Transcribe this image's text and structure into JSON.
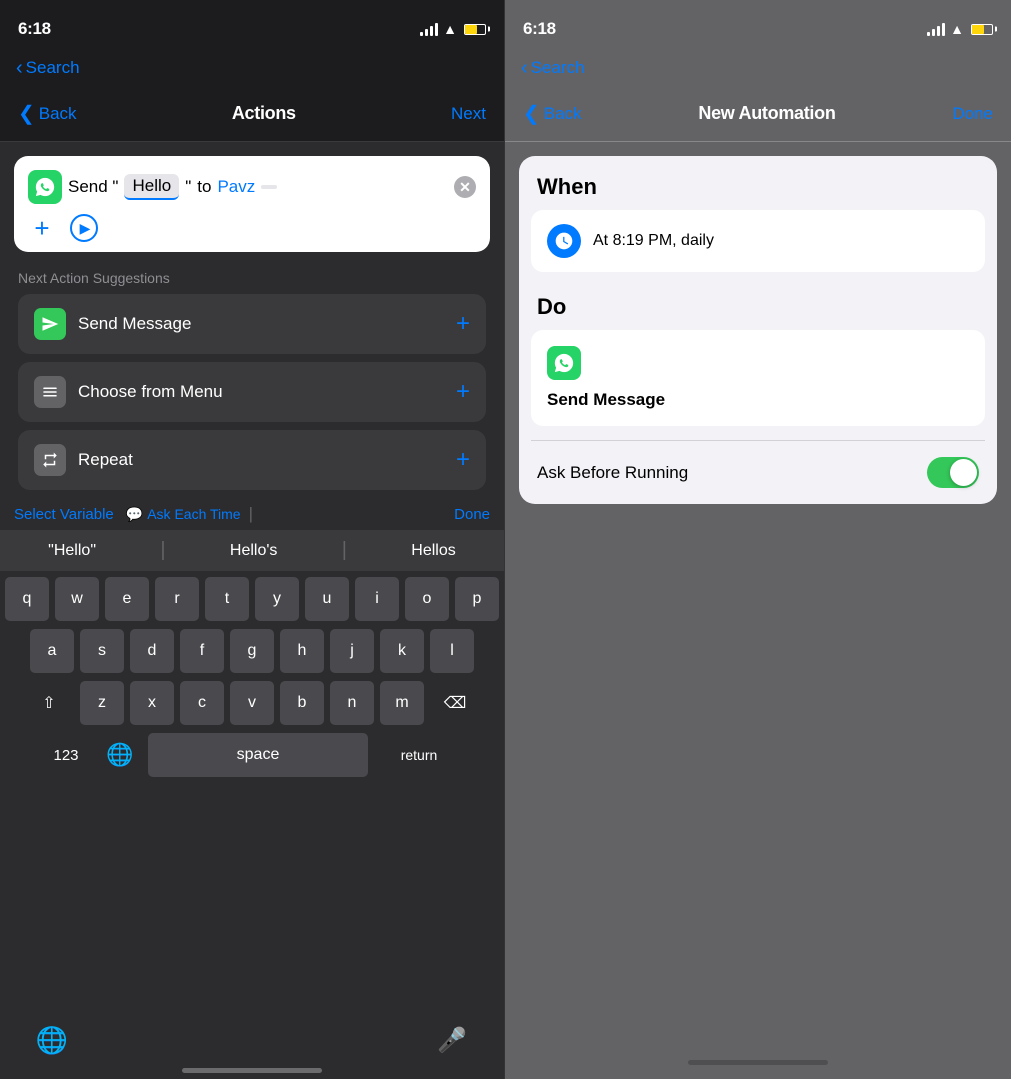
{
  "left": {
    "status": {
      "time": "6:18",
      "search_back": "Search"
    },
    "nav": {
      "back_label": "Back",
      "title": "Actions",
      "action_label": "Next"
    },
    "action_card": {
      "send_text": "Send \"",
      "hello_text": "Hello",
      "quote_close": "\"",
      "to_text": "to",
      "recipient": "Pavz"
    },
    "suggestions": {
      "label": "Next Action Suggestions",
      "items": [
        {
          "name": "Send Message",
          "icon_type": "green"
        },
        {
          "name": "Choose from Menu",
          "icon_type": "gray"
        },
        {
          "name": "Repeat",
          "icon_type": "gray"
        }
      ]
    },
    "toolbar": {
      "select_variable": "Select Variable",
      "ask_each_time": "Ask Each Time",
      "done": "Done"
    },
    "autocomplete": {
      "items": [
        "\"Hello\"",
        "Hello's",
        "Hellos"
      ]
    },
    "keyboard": {
      "rows": [
        [
          "q",
          "w",
          "e",
          "r",
          "t",
          "y",
          "u",
          "i",
          "o",
          "p"
        ],
        [
          "a",
          "s",
          "d",
          "f",
          "g",
          "h",
          "j",
          "k",
          "l"
        ],
        [
          "z",
          "x",
          "c",
          "v",
          "b",
          "n",
          "m"
        ]
      ],
      "bottom": {
        "nums": "123",
        "space": "space",
        "return": "return"
      }
    }
  },
  "right": {
    "status": {
      "time": "6:18",
      "search_back": "Search"
    },
    "nav": {
      "back_label": "Back",
      "title": "New Automation",
      "action_label": "Done"
    },
    "when_section": {
      "header": "When",
      "time_label": "At 8:19 PM, daily"
    },
    "do_section": {
      "header": "Do",
      "action_label": "Send Message"
    },
    "ask_before_running": {
      "label": "Ask Before Running"
    }
  },
  "icons": {
    "chevron_left": "❮",
    "plus": "+",
    "play": "▶",
    "message_bubble": "💬",
    "clock": "🕐",
    "whatsapp_color": "#25d366",
    "toggle_on_color": "#34c759"
  }
}
